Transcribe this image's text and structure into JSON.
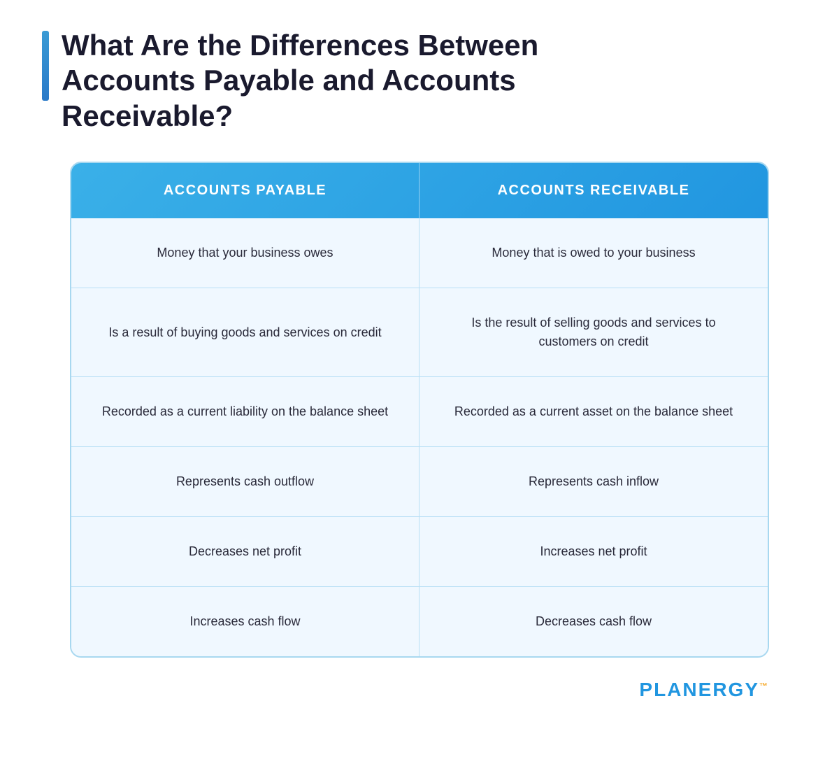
{
  "header": {
    "title": "What Are the Differences Between Accounts Payable and Accounts Receivable?"
  },
  "table": {
    "columns": [
      {
        "label": "ACCOUNTS PAYABLE"
      },
      {
        "label": "ACCOUNTS RECEIVABLE"
      }
    ],
    "rows": [
      {
        "left": "Money that your business owes",
        "right": "Money that is owed to your business"
      },
      {
        "left": "Is a result of buying goods and services on credit",
        "right": "Is the result of selling goods and services to customers on credit"
      },
      {
        "left": "Recorded as a current liability on the balance sheet",
        "right": "Recorded as a current asset on the balance sheet"
      },
      {
        "left": "Represents cash outflow",
        "right": "Represents cash inflow"
      },
      {
        "left": "Decreases net profit",
        "right": "Increases net profit"
      },
      {
        "left": "Increases cash flow",
        "right": "Decreases cash flow"
      }
    ]
  },
  "footer": {
    "logo_main": "PLANERGY",
    "logo_tm": "™"
  }
}
